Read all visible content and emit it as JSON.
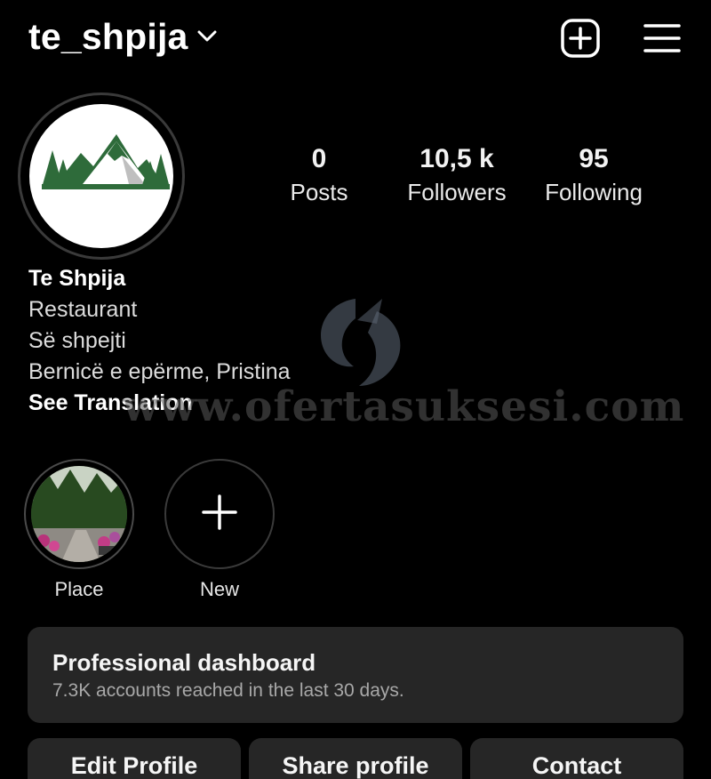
{
  "header": {
    "username": "te_shpija"
  },
  "stats": [
    {
      "value": "0",
      "label": "Posts"
    },
    {
      "value": "10,5 k",
      "label": "Followers"
    },
    {
      "value": "95",
      "label": "Following"
    }
  ],
  "bio": {
    "name": "Te Shpija",
    "category": "Restaurant",
    "line1": "Së shpejti",
    "location": "Bernicë e epërme, Pristina",
    "see_translation": "See Translation"
  },
  "watermark": {
    "text": "www.ofertasuksesi.com"
  },
  "highlights": [
    {
      "label": "Place"
    },
    {
      "label": "New"
    }
  ],
  "dashboard": {
    "title": "Professional dashboard",
    "subtitle": "7.3K accounts reached in the last 30 days."
  },
  "buttons": {
    "edit": "Edit Profile",
    "share": "Share profile",
    "contact": "Contact"
  },
  "icons": {
    "dropdown": "chevron-down-icon",
    "create": "plus-square-icon",
    "menu": "hamburger-menu-icon",
    "new_highlight": "plus-icon"
  },
  "colors": {
    "background": "#000000",
    "surface": "#262626",
    "logo_green": "#2e6b3a"
  }
}
